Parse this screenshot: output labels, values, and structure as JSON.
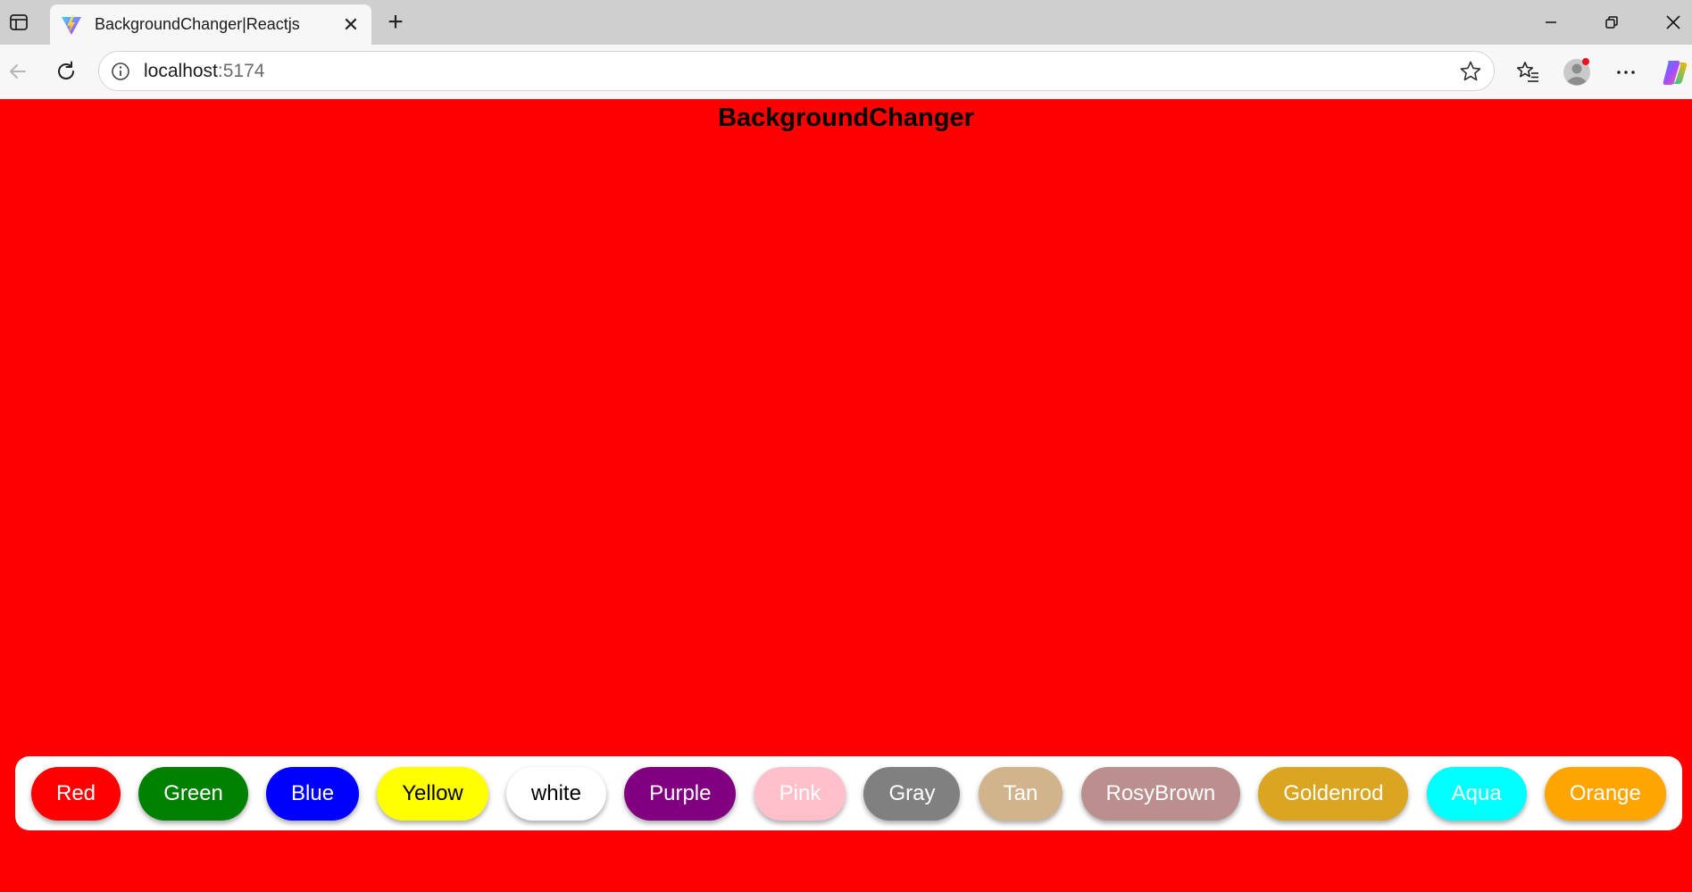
{
  "browser": {
    "tab": {
      "title": "BackgroundChanger|Reactjs",
      "close_glyph": "✕"
    },
    "new_tab_glyph": "+",
    "address": {
      "host": "localhost",
      "port": ":5174"
    },
    "window_controls": {
      "minimize": "—",
      "restore": "❐",
      "close": "✕"
    }
  },
  "page": {
    "background": "#ff0000",
    "title": "BackgroundChanger",
    "buttons": [
      {
        "label": "Red",
        "bg": "#ff0000",
        "fg": "#ffffff"
      },
      {
        "label": "Green",
        "bg": "#008000",
        "fg": "#ffffff"
      },
      {
        "label": "Blue",
        "bg": "#0000ff",
        "fg": "#ffffff"
      },
      {
        "label": "Yellow",
        "bg": "#ffff00",
        "fg": "#000000"
      },
      {
        "label": "white",
        "bg": "#ffffff",
        "fg": "#000000"
      },
      {
        "label": "Purple",
        "bg": "#800080",
        "fg": "#ffffff"
      },
      {
        "label": "Pink",
        "bg": "#ffc0cb",
        "fg": "#ffffff"
      },
      {
        "label": "Gray",
        "bg": "#808080",
        "fg": "#ffffff"
      },
      {
        "label": "Tan",
        "bg": "#d2b48c",
        "fg": "#ffffff"
      },
      {
        "label": "RosyBrown",
        "bg": "#bc8f8f",
        "fg": "#ffffff"
      },
      {
        "label": "Goldenrod",
        "bg": "#daa520",
        "fg": "#ffffff"
      },
      {
        "label": "Aqua",
        "bg": "#00ffff",
        "fg": "#ffffff"
      },
      {
        "label": "Orange",
        "bg": "#ffa500",
        "fg": "#ffffff"
      }
    ]
  }
}
